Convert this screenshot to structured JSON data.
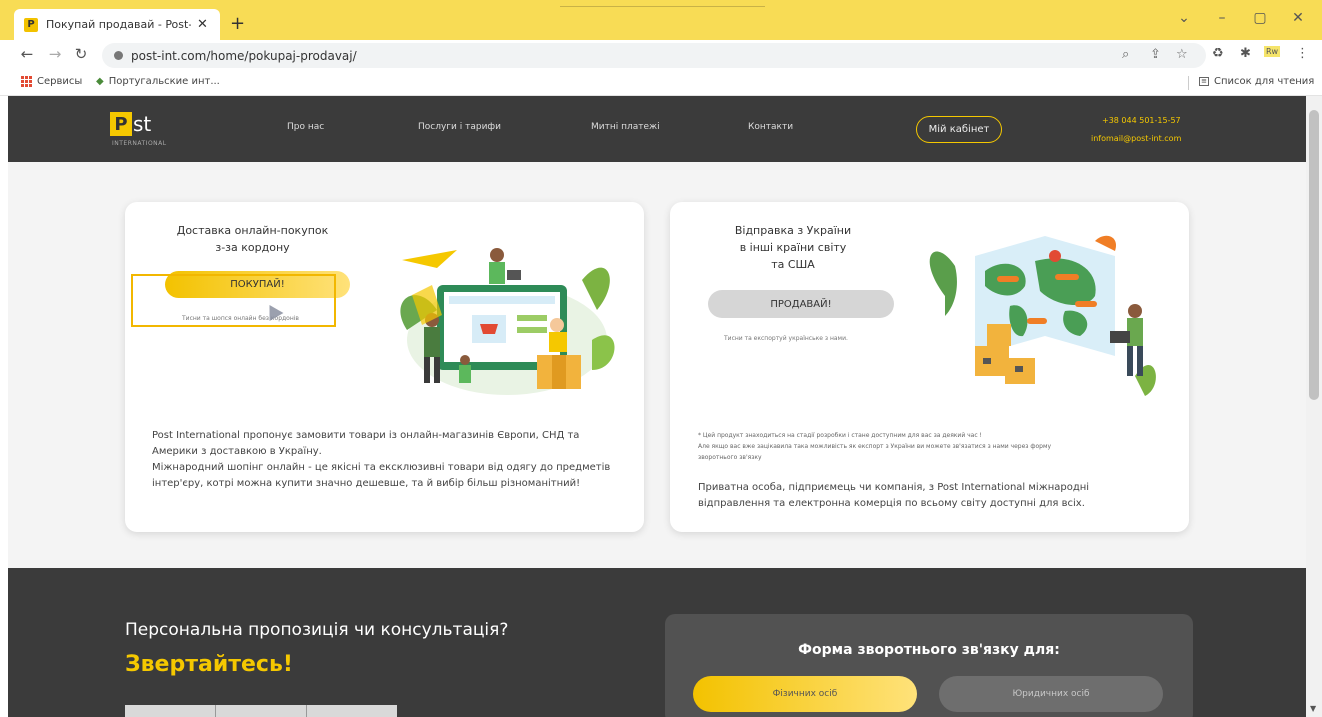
{
  "browser": {
    "tab_title": "Покупай продавай - Post-intern",
    "tab_favicon": "P",
    "url": "post-int.com/home/pokupaj-prodavaj/",
    "bookmarks": [
      "Сервисы",
      "Португальские инт..."
    ],
    "reading_list": "Список для чтения",
    "ext_label": "Rw"
  },
  "header": {
    "logo_p": "P",
    "logo_rest": "st",
    "logo_sub": "INTERNATIONAL",
    "nav": [
      "Про нас",
      "Послуги і тарифи",
      "Митні платежі",
      "Контакти"
    ],
    "cabinet": "Мій кабінет",
    "phone": "+38 044 501-15-57",
    "email": "infomail@post-int.com"
  },
  "card_buy": {
    "title_line1": "Доставка онлайн-покупок",
    "title_line2": "з-за кордону",
    "button": "ПОКУПАЙ!",
    "hint": "Тисни та шопся онлайн без кордонів",
    "desc_line1": "Post International пропонує замовити товари із онлайн-магазинів Європи, СНД та",
    "desc_line2": "Америки з доставкою в Україну.",
    "desc_line3": "Міжнародний шопінг онлайн - це якісні та ексклюзивні товари від одягу до предметів",
    "desc_line4": "інтер'єру, котрі можна купити значно дешевше, та й вибір більш різноманітний!"
  },
  "card_sell": {
    "title_line1": "Відправка з України",
    "title_line2": "в інші країни світу",
    "title_line3": "та США",
    "button": "ПРОДАВАЙ!",
    "hint": "Тисни та експортуй українське з нами.",
    "note_line1": "* Цей продукт знаходиться на стадії розробки і стане доступним для вас за деякий час !",
    "note_line2": "Але якщо вас вже зацікавила така можливість як експорт з України ви можете зв'язатися з нами через форму",
    "note_line3": "зворотнього зв'язку",
    "desc_line1": "Приватна особа, підприємець чи компанія, з Post International міжнародні",
    "desc_line2": "відправлення та електронна комерція по всьому світу доступні для всіх."
  },
  "cta": {
    "question": "Персональна пропозиція чи консультація?",
    "call": "Звертайтесь!"
  },
  "feedback_form": {
    "title": "Форма зворотнього зв'язку для:",
    "tab_individuals": "Фізичних осіб",
    "tab_legal": "Юридичних осіб"
  },
  "colors": {
    "brand_yellow": "#f5c800",
    "header_dark": "#3b3b3b",
    "tab_bar": "#f8dc55"
  }
}
